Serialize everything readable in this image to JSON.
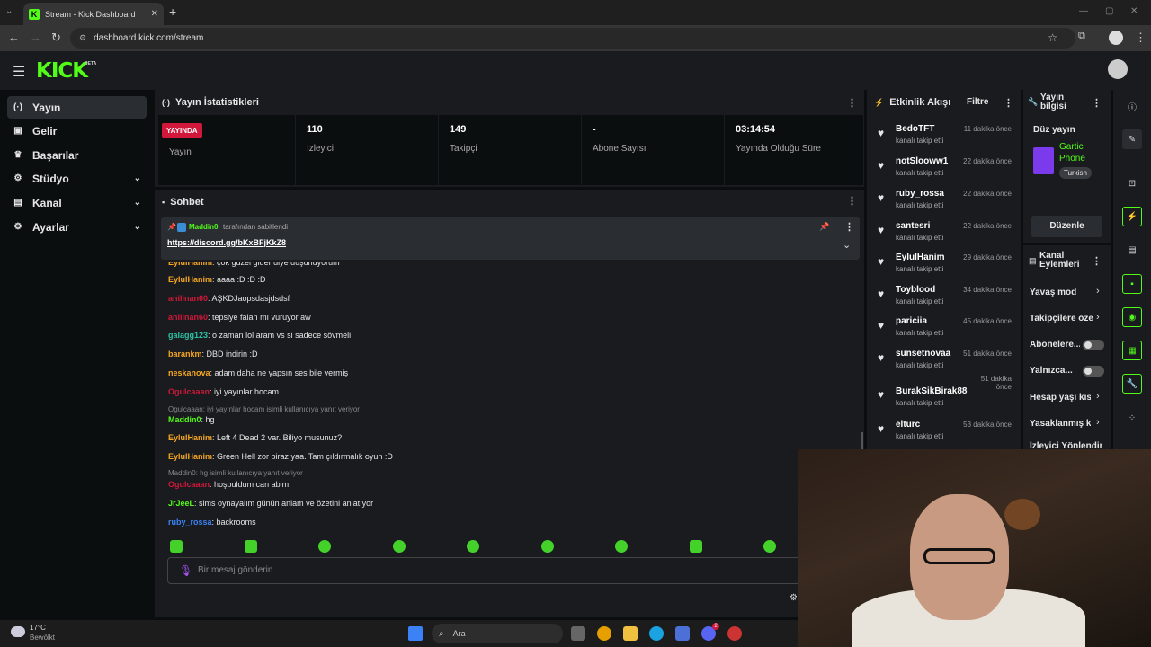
{
  "browser": {
    "tab_title": "Stream - Kick Dashboard",
    "tab_favicon": "K",
    "url": "dashboard.kick.com/stream"
  },
  "header": {
    "logo": "KICK",
    "logo_badge": "BETA"
  },
  "sidebar": {
    "items": [
      {
        "label": "Yayın",
        "icon": "broadcast-icon",
        "glyph": "(·)",
        "active": true,
        "chevron": false
      },
      {
        "label": "Gelir",
        "icon": "revenue-icon",
        "glyph": "▣",
        "active": false,
        "chevron": false
      },
      {
        "label": "Başarılar",
        "icon": "trophy-icon",
        "glyph": "🏆",
        "active": false,
        "chevron": false
      },
      {
        "label": "Stüdyo",
        "icon": "studio-icon",
        "glyph": "⚙",
        "active": false,
        "chevron": true
      },
      {
        "label": "Kanal",
        "icon": "channel-icon",
        "glyph": "▤",
        "active": false,
        "chevron": true
      },
      {
        "label": "Ayarlar",
        "icon": "settings-icon",
        "glyph": "⚙",
        "active": false,
        "chevron": true
      }
    ]
  },
  "stats": {
    "title": "Yayın İstatistikleri",
    "live_badge": "YAYINDA",
    "live_label": "Yayın",
    "cells": [
      {
        "value": "110",
        "label": "İzleyici"
      },
      {
        "value": "149",
        "label": "Takipçi"
      },
      {
        "value": "-",
        "label": "Abone Sayısı"
      },
      {
        "value": "03:14:54",
        "label": "Yayında Olduğu Süre"
      }
    ]
  },
  "chat": {
    "title": "Sohbet",
    "pinned_by": "Maddin0",
    "pinned_suffix": "tarafından sabitlendi",
    "pinned_link": "https://discord.gg/bKxBFjKkZ8",
    "messages": [
      {
        "user": "EylulHanim",
        "color": "#f5a623",
        "text": "çok güzel gider diye düşünüyorum"
      },
      {
        "user": "EylulHanim",
        "color": "#f5a623",
        "text": "aaaa :D :D :D"
      },
      {
        "user": "anilinan60",
        "color": "#d1183a",
        "text": "AŞKDJaopsdasjdsdsf"
      },
      {
        "user": "anilinan60",
        "color": "#d1183a",
        "text": "tepsiye falan mı vuruyor aw"
      },
      {
        "user": "galagg123",
        "color": "#2bc3a3",
        "text": "o zaman lol aram vs si sadece sövmeli"
      },
      {
        "user": "barankm",
        "color": "#f5a623",
        "text": "DBD indirin :D"
      },
      {
        "user": "neskanova",
        "color": "#f5a623",
        "text": "adam daha ne yapsın ses bile vermiş"
      },
      {
        "user": "Ogulcaaan",
        "color": "#d1183a",
        "text": "iyi yayınlar hocam"
      },
      {
        "reply": "Ogulcaaan: iyi yayınlar hocam isimli kullanıcıya yanıt veriyor"
      },
      {
        "user": "Maddin0",
        "color": "#53fc18",
        "text": "hg"
      },
      {
        "user": "EylulHanim",
        "color": "#f5a623",
        "text": "Left 4 Dead 2 var. Biliyo musunuz?"
      },
      {
        "user": "EylulHanim",
        "color": "#f5a623",
        "text": "Green Hell zor biraz yaa. Tam çıldırmalık oyun :D"
      },
      {
        "reply": "Maddin0: hg isimli kullanıcıya yanıt veriyor"
      },
      {
        "user": "Ogulcaaan",
        "color": "#d1183a",
        "text": "hoşbuldum can abim"
      },
      {
        "user": "JrJeeL",
        "color": "#53fc18",
        "text": "sims oynayalım günün anlam ve özetini anlatıyor"
      },
      {
        "user": "ruby_rossa",
        "color": "#3b82f6",
        "text": "backrooms"
      }
    ],
    "input_placeholder": "Bir mesaj gönderin"
  },
  "events": {
    "title": "Etkinlik Akışı",
    "filter": "Filtre",
    "items": [
      {
        "name": "BedoTFT",
        "sub": "kanalı takip etti",
        "time": "11 dakika önce"
      },
      {
        "name": "notSlooww1",
        "sub": "kanalı takip etti",
        "time": "22 dakika önce"
      },
      {
        "name": "ruby_rossa",
        "sub": "kanalı takip etti",
        "time": "22 dakika önce"
      },
      {
        "name": "santesri",
        "sub": "kanalı takip etti",
        "time": "22 dakika önce"
      },
      {
        "name": "EylulHanim",
        "sub": "kanalı takip etti",
        "time": "29 dakika önce"
      },
      {
        "name": "Toyblood",
        "sub": "kanalı takip etti",
        "time": "34 dakika önce"
      },
      {
        "name": "pariciia",
        "sub": "kanalı takip etti",
        "time": "45 dakika önce"
      },
      {
        "name": "sunsetnovaa",
        "sub": "kanalı takip etti",
        "time": "51 dakika önce"
      },
      {
        "name": "BurakSikBirak88",
        "sub": "kanalı takip etti",
        "time": "51 dakika önce"
      },
      {
        "name": "elturc",
        "sub": "kanalı takip etti",
        "time": "53 dakika önce"
      }
    ]
  },
  "stream_info": {
    "title": "Yayın bilgisi",
    "stream_title": "Düz yayın",
    "category": "Gartic Phone",
    "language": "Turkish",
    "edit_button": "Düzenle"
  },
  "channel_actions": {
    "title": "Kanal Eylemleri",
    "items": [
      {
        "label": "Yavaş mod",
        "kind": "chevron"
      },
      {
        "label": "Takipçilere öze",
        "kind": "chevron"
      },
      {
        "label": "Abonelere...",
        "kind": "toggle"
      },
      {
        "label": "Yalnızca...",
        "kind": "toggle"
      },
      {
        "label": "Hesap yaşı kısı",
        "kind": "chevron"
      },
      {
        "label": "Yasaklanmış ke",
        "kind": "chevron"
      },
      {
        "label": "İzleyici Yönlendir",
        "kind": "none"
      }
    ]
  },
  "taskbar": {
    "weather_temp": "17°C",
    "weather_text": "Bewölkt",
    "search_placeholder": "Ara",
    "badge_count": "2"
  },
  "colors": {
    "accent": "#53fc18",
    "live": "#d1183a",
    "panel": "#191b1f",
    "background": "#0b0e0f"
  }
}
